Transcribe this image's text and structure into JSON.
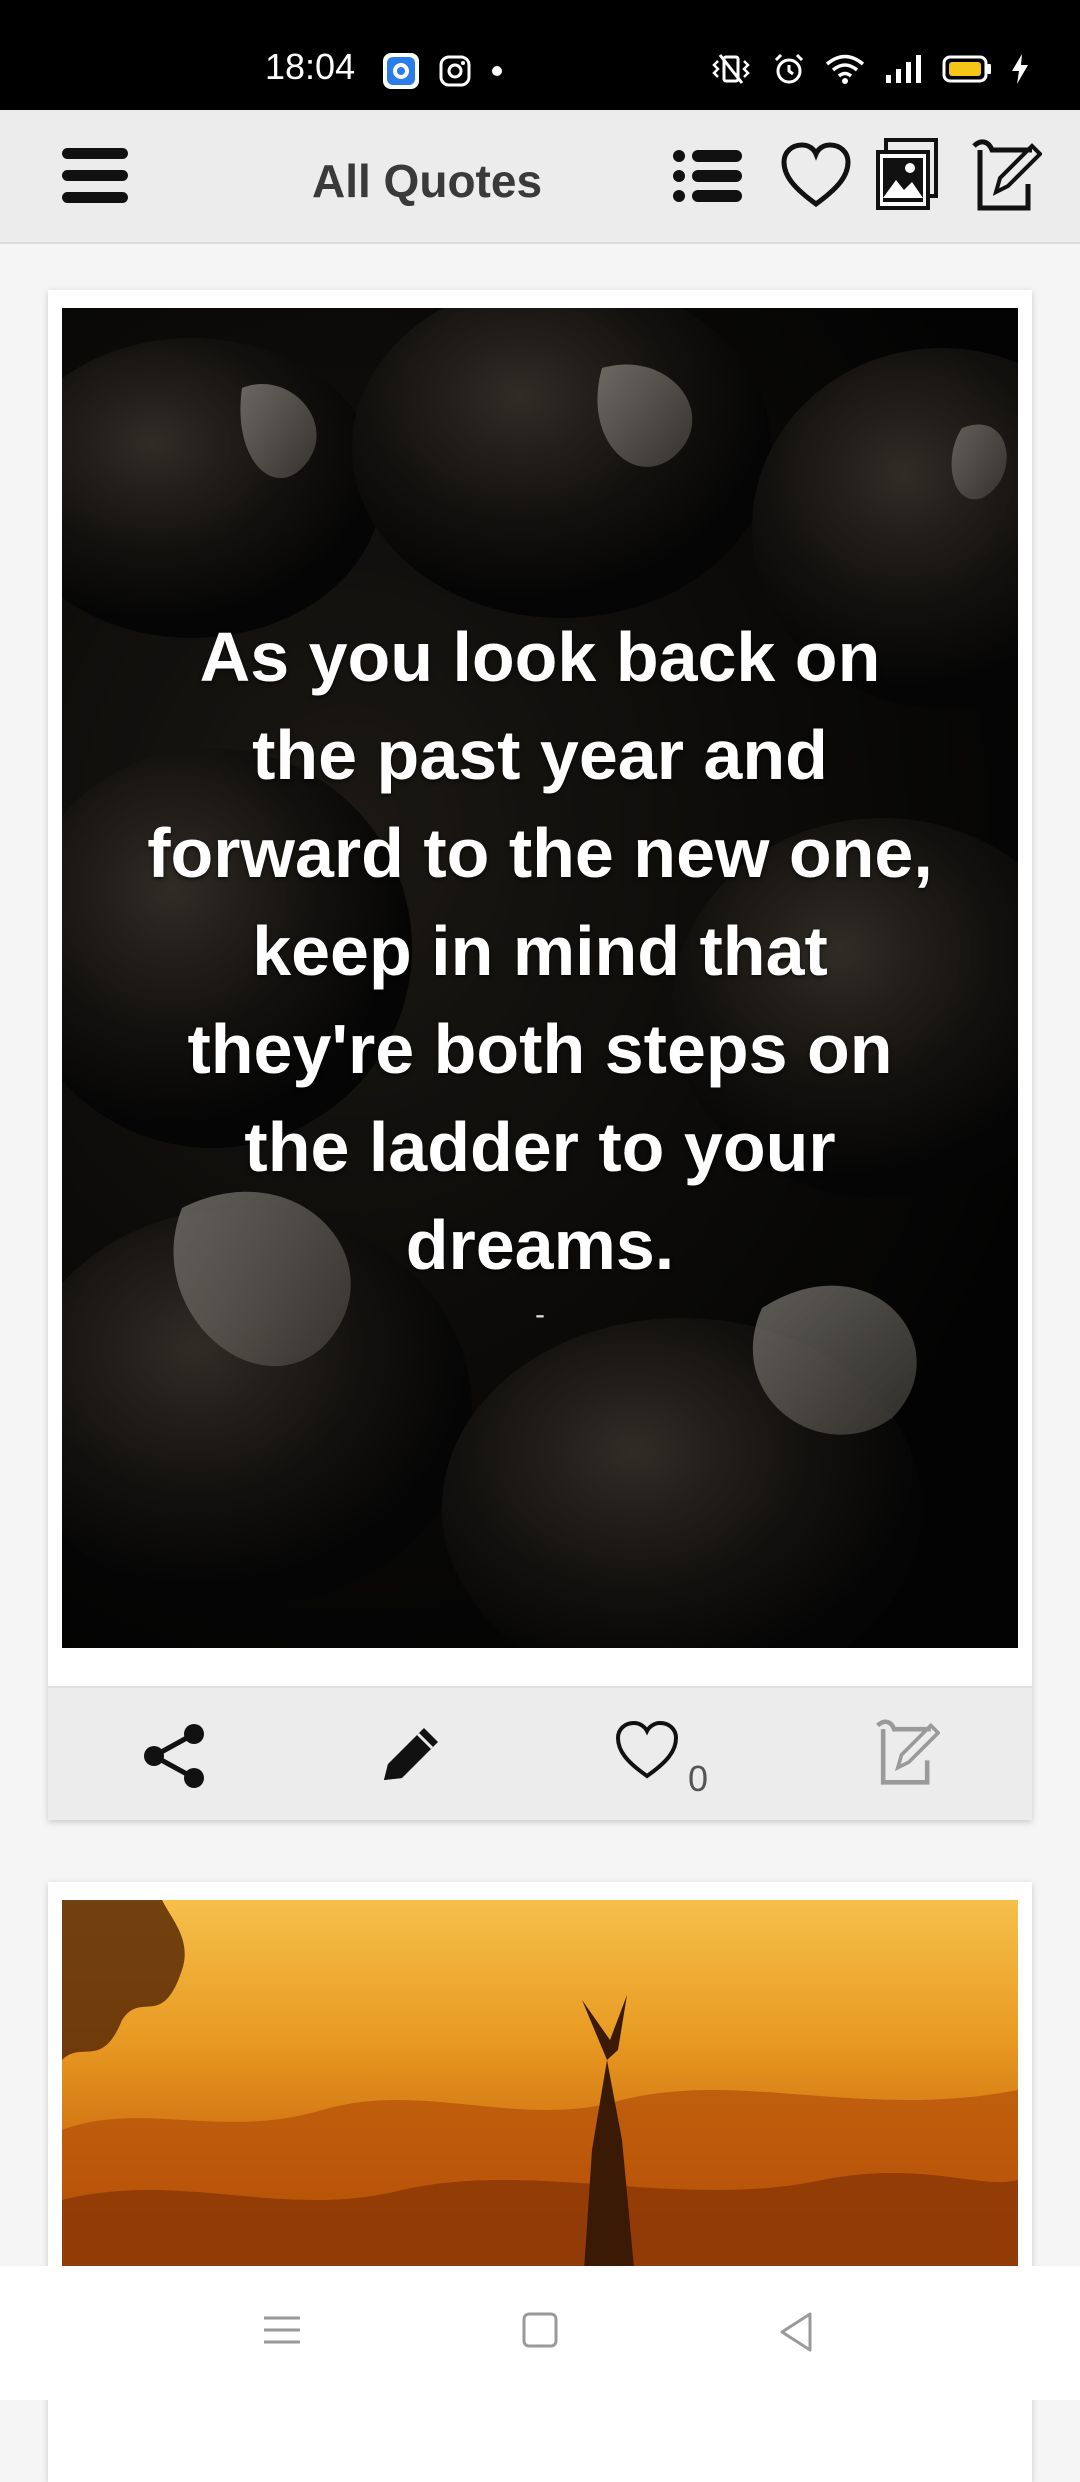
{
  "status_bar": {
    "time": "18:04",
    "left_icons": [
      "app-notification-icon",
      "instagram-icon",
      "dot-icon"
    ],
    "right_icons": [
      "vibrate-icon",
      "alarm-icon",
      "wifi-icon",
      "signal-icon",
      "battery-icon",
      "charging-icon"
    ],
    "battery_color": "#f5c518"
  },
  "app_bar": {
    "title": "All Quotes",
    "icons": [
      "menu-icon",
      "list-icon",
      "heart-icon",
      "gallery-icon",
      "edit-quote-icon"
    ]
  },
  "cards": [
    {
      "quote": "As you look back on the past year and forward to the new one, keep in mind that they're both steps on the ladder to your dreams.",
      "author": "-",
      "like_count": "0",
      "actions": [
        "share-icon",
        "pencil-icon",
        "heart-icon",
        "edit-quote-icon"
      ]
    },
    {
      "quote": "",
      "author": ""
    }
  ],
  "nav_bar": {
    "buttons": [
      "recents-icon",
      "home-icon",
      "back-icon"
    ]
  },
  "colors": {
    "status_bar_bg": "#000000",
    "app_bar_bg": "#ececec",
    "page_bg": "#f5f5f5",
    "title_color": "#3a3a3a"
  }
}
